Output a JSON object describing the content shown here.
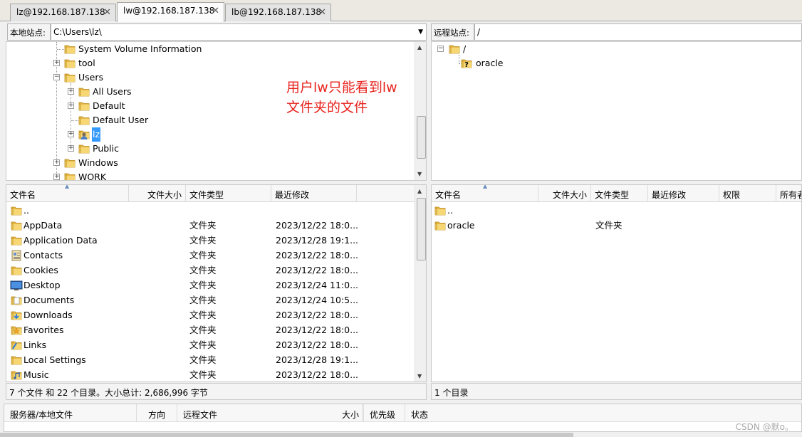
{
  "tabs": [
    {
      "label": "lz@192.168.187.138"
    },
    {
      "label": "lw@192.168.187.138"
    },
    {
      "label": "lb@192.168.187.138"
    }
  ],
  "tab_close_glyph": "✕",
  "local": {
    "site_label": "本地站点:",
    "path": "C:\\Users\\lz\\",
    "tree": [
      {
        "label": "System Volume Information"
      },
      {
        "label": "tool"
      },
      {
        "label": "Users"
      },
      {
        "label": "All Users"
      },
      {
        "label": "Default"
      },
      {
        "label": "Default User"
      },
      {
        "label": "lz"
      },
      {
        "label": "Public"
      },
      {
        "label": "Windows"
      },
      {
        "label": "WORK"
      }
    ],
    "columns": [
      "文件名",
      "文件大小",
      "文件类型",
      "最近修改"
    ],
    "files": [
      {
        "name": "..",
        "type": "",
        "modified": "",
        "icon": "folder-icon"
      },
      {
        "name": "AppData",
        "type": "文件夹",
        "modified": "2023/12/22 18:0...",
        "icon": "folder-icon"
      },
      {
        "name": "Application Data",
        "type": "文件夹",
        "modified": "2023/12/28 19:1...",
        "icon": "folder-icon"
      },
      {
        "name": "Contacts",
        "type": "文件夹",
        "modified": "2023/12/22 18:0...",
        "icon": "contacts-icon"
      },
      {
        "name": "Cookies",
        "type": "文件夹",
        "modified": "2023/12/22 18:0...",
        "icon": "folder-icon"
      },
      {
        "name": "Desktop",
        "type": "文件夹",
        "modified": "2023/12/24 11:0...",
        "icon": "desktop-icon"
      },
      {
        "name": "Documents",
        "type": "文件夹",
        "modified": "2023/12/24 10:5...",
        "icon": "documents-icon"
      },
      {
        "name": "Downloads",
        "type": "文件夹",
        "modified": "2023/12/22 18:0...",
        "icon": "downloads-icon"
      },
      {
        "name": "Favorites",
        "type": "文件夹",
        "modified": "2023/12/22 18:0...",
        "icon": "favorites-icon"
      },
      {
        "name": "Links",
        "type": "文件夹",
        "modified": "2023/12/22 18:0...",
        "icon": "links-icon"
      },
      {
        "name": "Local Settings",
        "type": "文件夹",
        "modified": "2023/12/28 19:1...",
        "icon": "folder-icon"
      },
      {
        "name": "Music",
        "type": "文件夹",
        "modified": "2023/12/22 18:0...",
        "icon": "music-icon"
      }
    ],
    "status": "7 个文件 和 22 个目录。大小总计: 2,686,996 字节"
  },
  "remote": {
    "site_label": "远程站点:",
    "path": "/",
    "tree": [
      {
        "label": "/"
      },
      {
        "label": "oracle"
      }
    ],
    "columns": [
      "文件名",
      "文件大小",
      "文件类型",
      "最近修改",
      "权限",
      "所有者"
    ],
    "files": [
      {
        "name": "..",
        "type": ""
      },
      {
        "name": "oracle",
        "type": "文件夹"
      }
    ],
    "status": "1 个目录"
  },
  "queue": {
    "columns": [
      "服务器/本地文件",
      "方向",
      "远程文件",
      "大小",
      "优先级",
      "状态"
    ]
  },
  "annotation": [
    "用户lw只能看到lw",
    "文件夹的文件"
  ],
  "watermark": "CSDN @默o。",
  "colors": {
    "annotation": "#e8231d",
    "selection": "#3399ff",
    "folder": "#f2c94c"
  }
}
